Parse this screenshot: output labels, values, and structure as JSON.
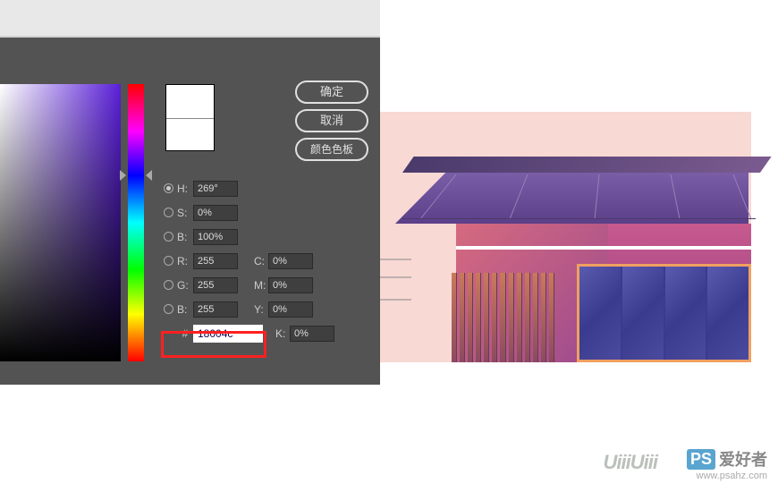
{
  "dialog": {
    "buttons": {
      "ok": "确定",
      "cancel": "取消",
      "swatch": "颜色色板"
    },
    "hsv": {
      "h_label": "H:",
      "h_value": "269°",
      "s_label": "S:",
      "s_value": "0%",
      "b_label": "B:",
      "b_value": "100%"
    },
    "rgb": {
      "r_label": "R:",
      "r_value": "255",
      "g_label": "G:",
      "g_value": "255",
      "b_label": "B:",
      "b_value": "255"
    },
    "cmyk": {
      "c_label": "C:",
      "c_value": "0%",
      "m_label": "M:",
      "m_value": "0%",
      "y_label": "Y:",
      "y_value": "0%",
      "k_label": "K:",
      "k_value": "0%"
    },
    "hex": {
      "hash": "#",
      "value": "18004c"
    }
  },
  "watermark": {
    "ps": "PS",
    "cn": "爱好者",
    "url": "www.psahz.com",
    "uiii": "UiiiUiii"
  }
}
